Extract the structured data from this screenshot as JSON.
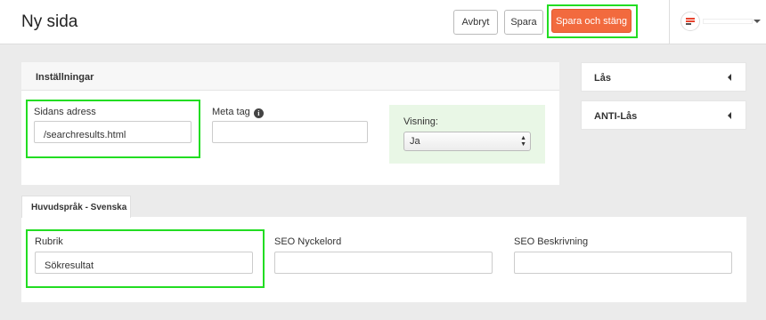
{
  "header": {
    "title": "Ny sida",
    "cancel_label": "Avbryt",
    "save_label": "Spara",
    "save_close_label": "Spara och stäng"
  },
  "settings": {
    "title": "Inställningar",
    "address": {
      "label": "Sidans adress",
      "value": "/searchresults.html"
    },
    "meta": {
      "label": "Meta tag",
      "value": ""
    },
    "visning": {
      "label": "Visning:",
      "selected": "Ja"
    }
  },
  "side": {
    "lock": "Lås",
    "anti_lock": "ANTI-Lås"
  },
  "language": {
    "tab_label": "Huvudspråk - Svenska",
    "rubrik": {
      "label": "Rubrik",
      "value": "Sökresultat"
    },
    "seo_keywords": {
      "label": "SEO Nyckelord",
      "value": ""
    },
    "seo_description": {
      "label": "SEO Beskrivning",
      "value": ""
    }
  },
  "colors": {
    "primary": "#f26a3e",
    "highlight": "#22dd22",
    "visning_bg": "#e9f7e6"
  },
  "icons": [
    "info-icon",
    "chevron-left-icon",
    "caret-down-icon",
    "logo-icon",
    "select-arrows-icon"
  ]
}
